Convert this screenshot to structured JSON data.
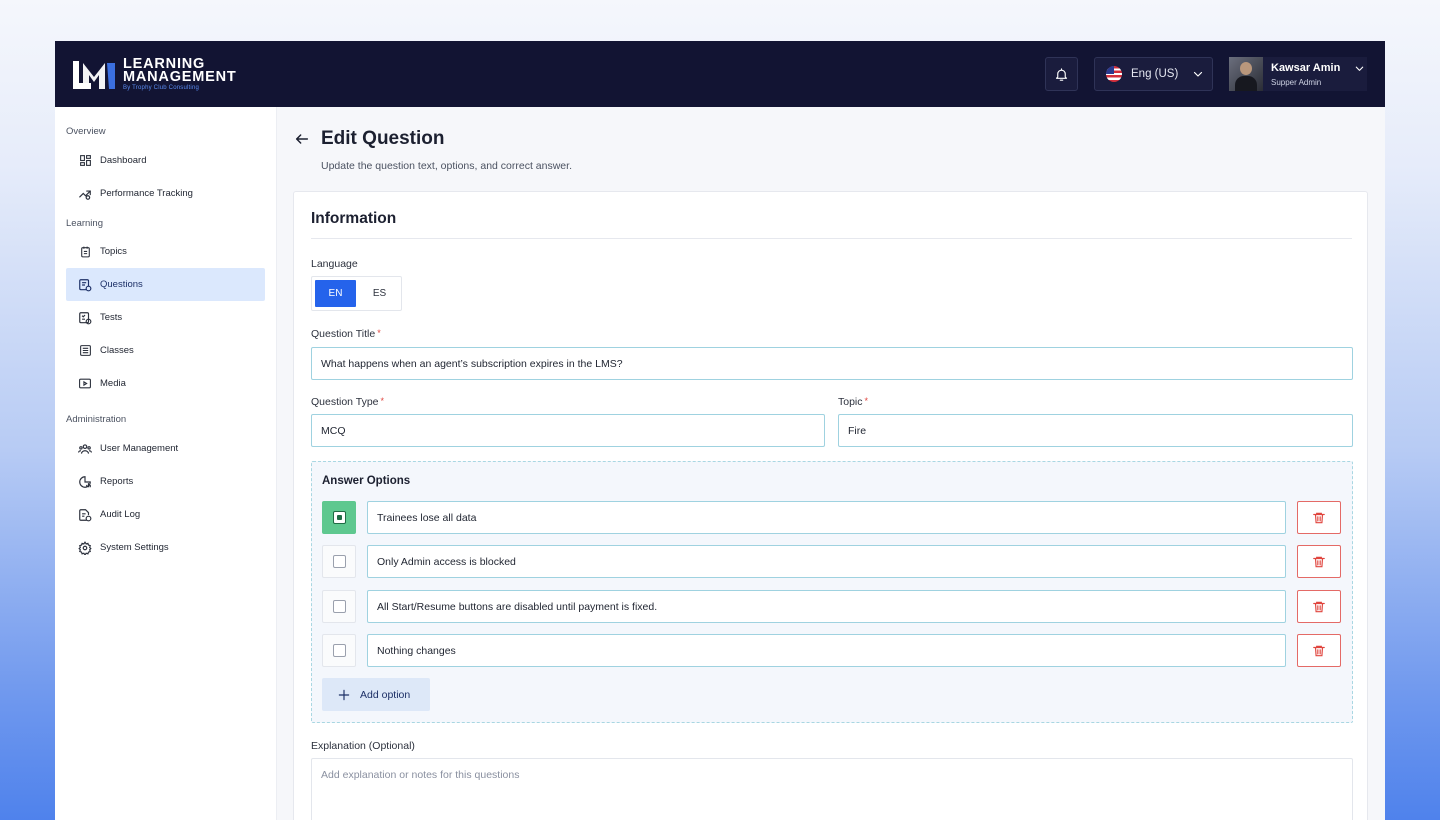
{
  "header": {
    "logo": {
      "line1": "LEARNING",
      "line2": "MANAGEMENT",
      "sub": "By Trophy Club Consulting"
    },
    "language": {
      "label": "Eng (US)"
    },
    "user": {
      "name": "Kawsar Amin",
      "role": "Supper Admin"
    }
  },
  "sidebar": {
    "sections": [
      {
        "label": "Overview"
      },
      {
        "label": "Learning"
      },
      {
        "label": "Administration"
      }
    ],
    "items": [
      {
        "label": "Dashboard",
        "icon": "dashboard-icon"
      },
      {
        "label": "Performance Tracking",
        "icon": "performance-icon"
      },
      {
        "label": "Topics",
        "icon": "topics-icon"
      },
      {
        "label": "Questions",
        "icon": "questions-icon",
        "active": true
      },
      {
        "label": "Tests",
        "icon": "tests-icon"
      },
      {
        "label": "Classes",
        "icon": "classes-icon"
      },
      {
        "label": "Media",
        "icon": "media-icon"
      },
      {
        "label": "User Management",
        "icon": "users-icon"
      },
      {
        "label": "Reports",
        "icon": "reports-icon"
      },
      {
        "label": "Audit Log",
        "icon": "audit-icon"
      },
      {
        "label": "System Settings",
        "icon": "settings-icon"
      }
    ]
  },
  "page": {
    "title": "Edit Question",
    "subtitle": "Update the question text, options, and correct answer."
  },
  "form": {
    "section_title": "Information",
    "language": {
      "label": "Language",
      "options": [
        "EN",
        "ES"
      ],
      "selected": "EN"
    },
    "question_title": {
      "label": "Question Title",
      "required_mark": "*",
      "value": "What happens when an agent’s subscription expires in the LMS?"
    },
    "question_type": {
      "label": "Question Type",
      "required_mark": "*",
      "value": "MCQ"
    },
    "topic": {
      "label": "Topic",
      "required_mark": "*",
      "value": "Fire"
    },
    "answers": {
      "title": "Answer Options",
      "options": [
        {
          "text": "Trainees lose all data",
          "correct": true
        },
        {
          "text": "Only Admin access is blocked",
          "correct": false
        },
        {
          "text": "All Start/Resume buttons are disabled until payment is fixed.",
          "correct": false
        },
        {
          "text": "Nothing changes",
          "correct": false
        }
      ],
      "add_label": "Add option"
    },
    "explanation": {
      "label": "Explanation (Optional)",
      "placeholder": "Add explanation or notes for this questions"
    }
  },
  "colors": {
    "topbar": "#121433",
    "primary": "#2563eb",
    "correct": "#5ec88f",
    "danger": "#e46a66",
    "active_nav": "#dbe8fd"
  }
}
